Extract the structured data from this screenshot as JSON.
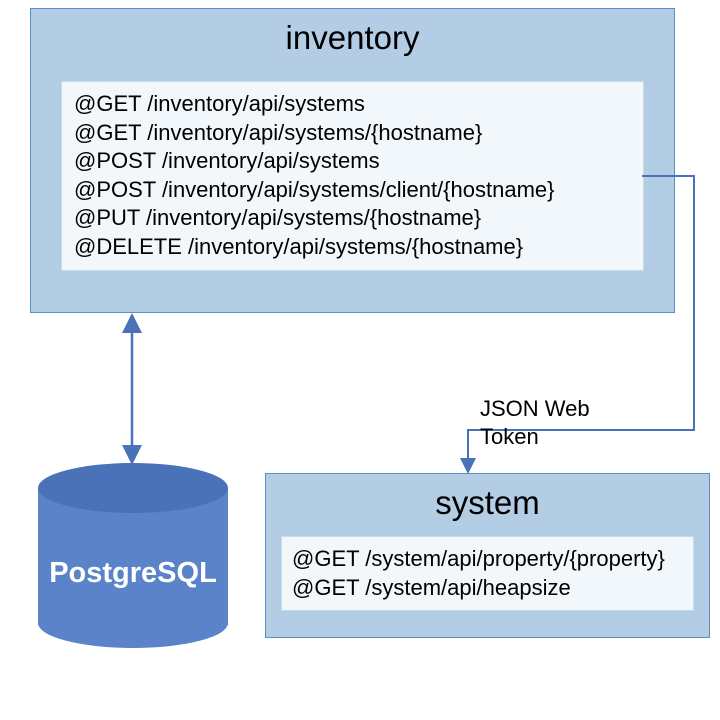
{
  "inventory": {
    "title": "inventory",
    "endpoints": [
      "@GET /inventory/api/systems",
      "@GET /inventory/api/systems/{hostname}",
      "@POST /inventory/api/systems",
      "@POST /inventory/api/systems/client/{hostname}",
      "@PUT /inventory/api/systems/{hostname}",
      "@DELETE /inventory/api/systems/{hostname}"
    ]
  },
  "system": {
    "title": "system",
    "endpoints": [
      "@GET /system/api/property/{property}",
      "@GET /system/api/heapsize"
    ]
  },
  "database": {
    "label": "PostgreSQL"
  },
  "connector": {
    "label_line1": "JSON Web",
    "label_line2": "Token"
  },
  "colors": {
    "box_bg": "#b3cde4",
    "box_border": "#5a8fc5",
    "panel_bg": "#f2f7fb",
    "db_top": "#4a72b8",
    "db_body": "#5b83c9",
    "arrow": "#4a72b8"
  }
}
